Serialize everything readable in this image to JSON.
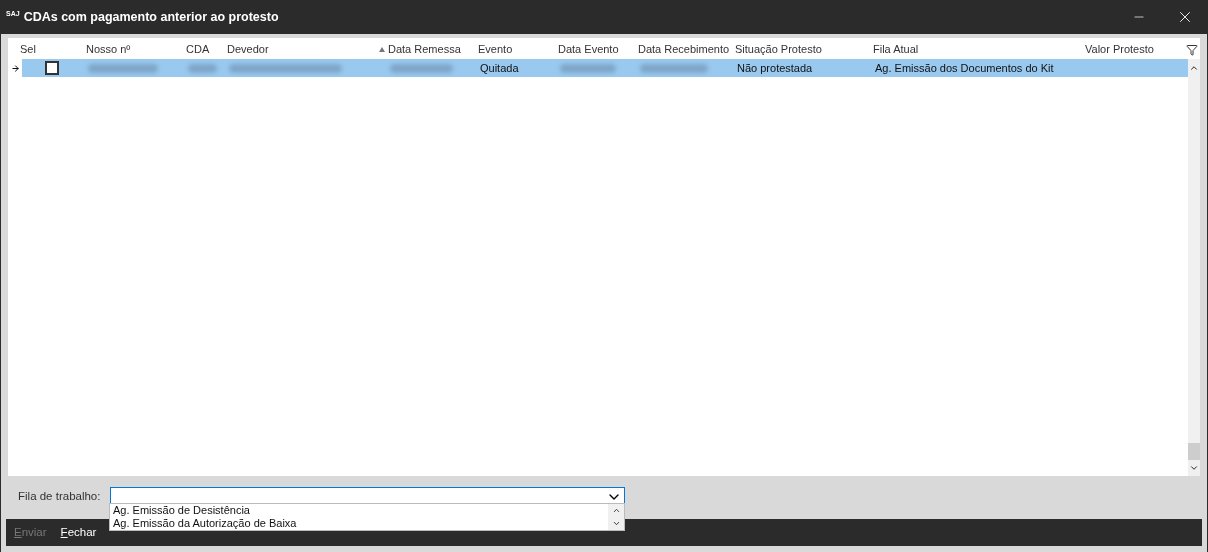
{
  "window": {
    "logo": "SAJ",
    "title": "CDAs com pagamento anterior ao protesto"
  },
  "table": {
    "columns": [
      {
        "label": "Sel",
        "sorted": false
      },
      {
        "label": "Nosso nº",
        "sorted": false
      },
      {
        "label": "CDA",
        "sorted": false
      },
      {
        "label": "Devedor",
        "sorted": false
      },
      {
        "label": "Data Remessa",
        "sorted": true
      },
      {
        "label": "Evento",
        "sorted": false
      },
      {
        "label": "Data Evento",
        "sorted": false
      },
      {
        "label": "Data Recebimento",
        "sorted": false
      },
      {
        "label": "Situação Protesto",
        "sorted": false
      },
      {
        "label": "Fila Atual",
        "sorted": false
      },
      {
        "label": "Valor Protesto",
        "sorted": false
      }
    ],
    "rows": [
      {
        "current": true,
        "selected": true,
        "cells": [
          {
            "kind": "checkbox",
            "checked": false
          },
          {
            "kind": "redacted"
          },
          {
            "kind": "redacted"
          },
          {
            "kind": "redacted"
          },
          {
            "kind": "redacted"
          },
          {
            "kind": "text",
            "text": "Quitada"
          },
          {
            "kind": "redacted"
          },
          {
            "kind": "redacted"
          },
          {
            "kind": "text",
            "text": "Não protestada"
          },
          {
            "kind": "text",
            "text": "Ag. Emissão dos Documentos do Kit"
          },
          {
            "kind": "empty"
          }
        ]
      }
    ]
  },
  "work_queue": {
    "label": "Fila de trabalho:",
    "options": [
      "Ag. Emissão de Desistência",
      "Ag. Emissão da Autorização de Baixa"
    ]
  },
  "footer": {
    "buttons": [
      {
        "label": "Enviar",
        "disabled": true
      },
      {
        "label": "Fechar",
        "disabled": false
      }
    ]
  }
}
